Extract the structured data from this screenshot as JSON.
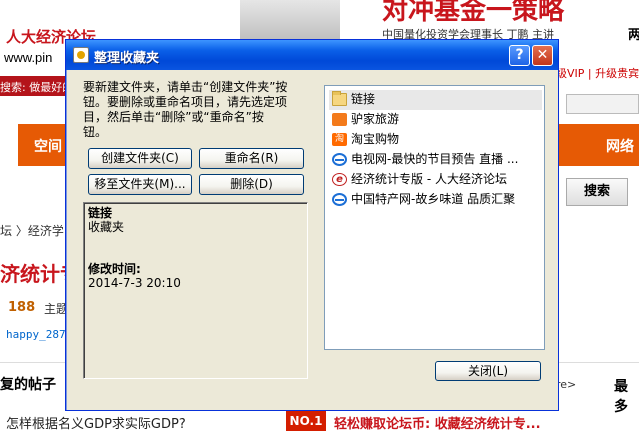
{
  "background": {
    "site_logo": "人大经济论坛",
    "url_fragment": "www.pin",
    "ad_title": "对冲基金一策略",
    "ad_subtitle": "中国量化投资学会理事长   丁鹏   主讲",
    "ad_subtitle2": "两",
    "red_bar_text": "搜索: 做最好的",
    "vip_text": "级VIP  |  升级贵宾",
    "nav_left": "空间",
    "nav_right": "网络",
    "search_button": "搜索",
    "breadcrumb": "坛  〉经济学",
    "category_title": "济统计专",
    "count": "188",
    "count_label": "主题",
    "user_link": "happy_287",
    "reply_heading": "复的帖子",
    "more_arrow": "re>",
    "most_heading": "最多",
    "question": "怎样根据名义GDP求实际GDP?",
    "no1_badge": "NO.1",
    "promo_text": "轻松赚取论坛币: 收藏经济统计专..."
  },
  "dialog": {
    "title": "整理收藏夹",
    "help_label": "?",
    "close_x_label": "✕",
    "instructions": "要新建文件夹，请单击“创建文件夹”按\n钮。要删除或重命名项目，请先选定项\n目，然后单击“删除”或“重命名”按\n钮。",
    "buttons": {
      "create": "创建文件夹(C)",
      "rename": "重命名(R)",
      "move": "移至文件夹(M)...",
      "delete": "删除(D)",
      "close": "关闭(L)"
    },
    "info": {
      "name": "链接",
      "type": "收藏夹",
      "modified_label": "修改时间:",
      "modified_value": "2014-7-3 20:10"
    },
    "favorites": [
      {
        "label": "链接",
        "icon": "folder-icon",
        "selected": true
      },
      {
        "label": "驴家旅游",
        "icon": "lvjia-icon"
      },
      {
        "label": "淘宝购物",
        "icon": "taobao-icon"
      },
      {
        "label": "电视网-最快的节目预告 直播 ...",
        "icon": "ie-icon"
      },
      {
        "label": "经济统计专版 - 人大经济论坛",
        "icon": "econ-forum-icon"
      },
      {
        "label": "中国特产网-故乡味道 品质汇聚",
        "icon": "ie-icon"
      }
    ]
  },
  "colors": {
    "titlebar": "#0a5fe8",
    "dialog_face": "#ece9d8",
    "brand_red": "#c8161d",
    "nav_orange": "#e65a05"
  }
}
